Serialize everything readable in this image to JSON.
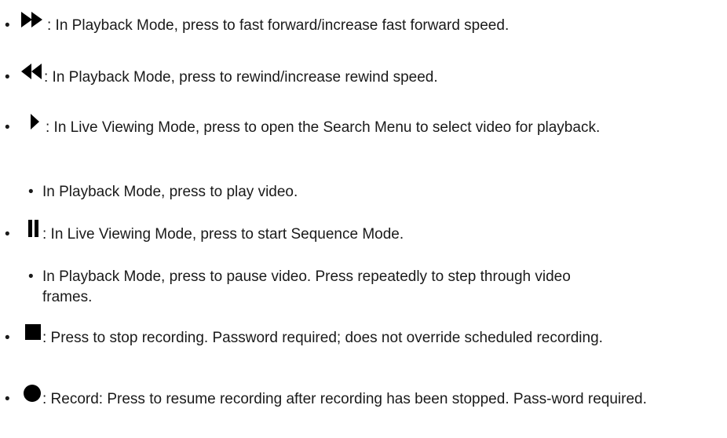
{
  "bullet_char": "•",
  "items": [
    {
      "icon": "fast-forward-icon",
      "text": ": In Playback Mode, press to fast forward/increase fast forward speed."
    },
    {
      "icon": "rewind-icon",
      "text": ": In Playback Mode, press to rewind/increase rewind speed."
    },
    {
      "icon": "play-icon",
      "text": ": In Live Viewing Mode, press to open the Search Menu to select video for playback.",
      "sub": "In Playback Mode, press to play video."
    },
    {
      "icon": "pause-icon",
      "text": ": In Live Viewing Mode, press to start Sequence Mode.",
      "sub": "In Playback Mode, press to pause video. Press repeatedly to step through video frames."
    },
    {
      "icon": "stop-icon",
      "text": ": Press to stop recording. Password required; does not override scheduled recording."
    },
    {
      "icon": "record-icon",
      "text": ": Record: Press to resume recording after recording has been stopped. Pass-word required."
    }
  ],
  "colors": {
    "text": "#1a1a1a",
    "icon": "#000000"
  }
}
